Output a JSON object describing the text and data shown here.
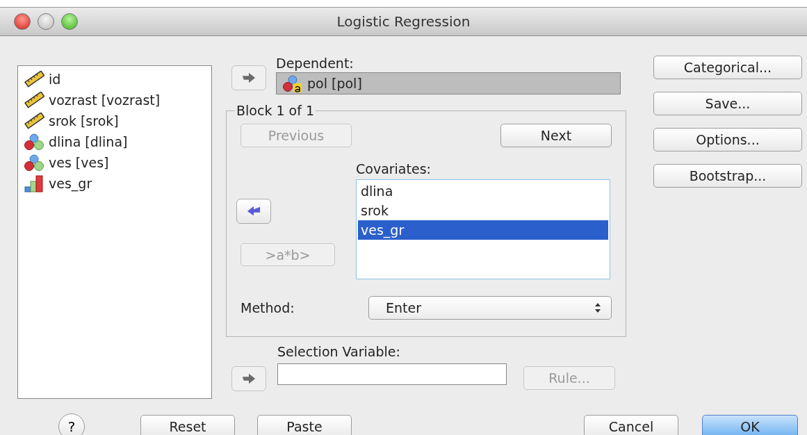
{
  "window": {
    "title": "Logistic Regression"
  },
  "variables": [
    {
      "label": "id",
      "kind": "scale",
      "selected": false
    },
    {
      "label": "vozrast [vozrast]",
      "kind": "scale",
      "selected": false
    },
    {
      "label": "srok [srok]",
      "kind": "scale",
      "selected": false
    },
    {
      "label": "dlina [dlina]",
      "kind": "nominal",
      "selected": false
    },
    {
      "label": "ves [ves]",
      "kind": "nominal",
      "selected": false
    },
    {
      "label": "ves_gr",
      "kind": "ordinal",
      "selected": false
    }
  ],
  "dependent": {
    "label": "Dependent:",
    "value": "pol [pol]",
    "kind": "nominal-string",
    "arrow_disabled": true
  },
  "block": {
    "title": "Block 1 of 1",
    "previous": {
      "label": "Previous",
      "disabled": true
    },
    "next": {
      "label": "Next",
      "disabled": false
    },
    "arrow_disabled": false,
    "interaction": {
      "label": ">a*b>",
      "disabled": true
    },
    "covariates_label": "Covariates:",
    "covariates": [
      {
        "label": "dlina",
        "selected": false
      },
      {
        "label": "srok",
        "selected": false
      },
      {
        "label": "ves_gr",
        "selected": true
      }
    ],
    "method_label": "Method:",
    "method": "Enter"
  },
  "selection": {
    "label": "Selection Variable:",
    "arrow_disabled": true,
    "rule": {
      "label": "Rule...",
      "disabled": true
    }
  },
  "side_buttons": [
    "Categorical...",
    "Save...",
    "Options...",
    "Bootstrap..."
  ],
  "help": "?",
  "bottom_buttons": [
    {
      "label": "Reset",
      "default": false
    },
    {
      "label": "Paste",
      "default": false
    },
    {
      "label": "Cancel",
      "default": false
    },
    {
      "label": "OK",
      "default": true
    }
  ]
}
